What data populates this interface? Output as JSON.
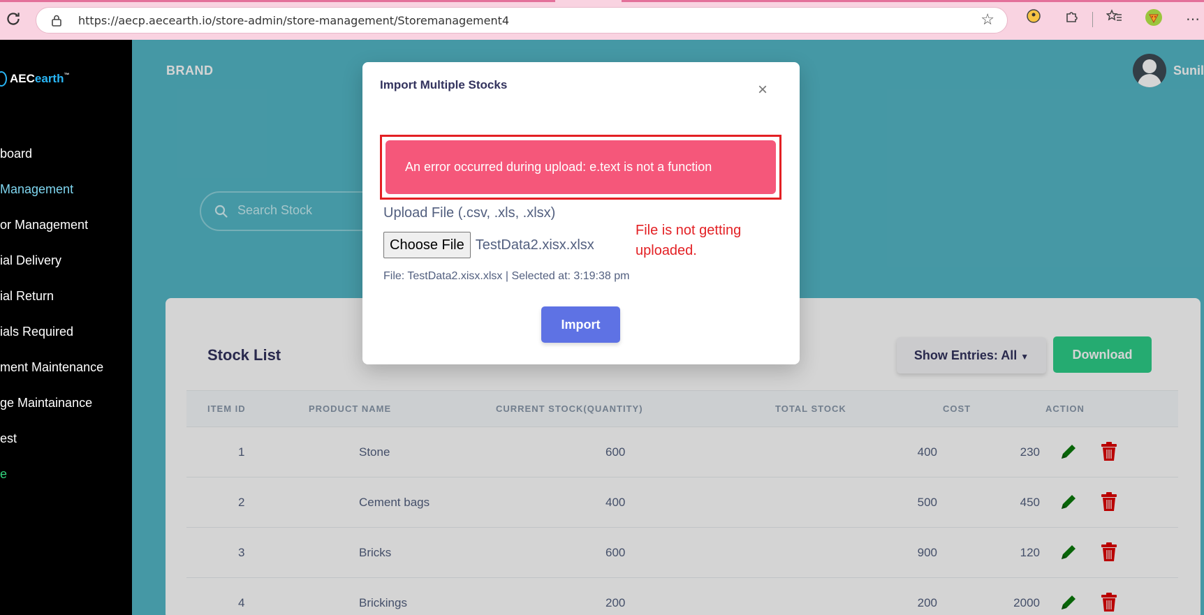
{
  "browser": {
    "url": "https://aecp.aecearth.io/store-admin/store-management/Storemanagement4"
  },
  "sidebar": {
    "logo": {
      "prefix": "AEC",
      "suffix": "earth",
      "tm": "™"
    },
    "items": [
      {
        "label": "board"
      },
      {
        "label": "Management"
      },
      {
        "label": "or Management"
      },
      {
        "label": "ial Delivery"
      },
      {
        "label": "ial Return"
      },
      {
        "label": "ials Required"
      },
      {
        "label": "ment Maintenance"
      },
      {
        "label": "ge Maintainance"
      },
      {
        "label": "est"
      },
      {
        "label": "e"
      }
    ]
  },
  "header": {
    "brand": "BRAND",
    "user_name": "Sunil"
  },
  "search": {
    "placeholder": "Search Stock"
  },
  "stock_list": {
    "title": "Stock List",
    "entries_label": "Show Entries: All",
    "download_label": "Download",
    "columns": [
      "ITEM ID",
      "PRODUCT NAME",
      "CURRENT STOCK(QUANTITY)",
      "TOTAL STOCK",
      "COST",
      "ACTION"
    ],
    "rows": [
      {
        "id": "1",
        "name": "Stone",
        "current": "600",
        "total": "400",
        "cost": "230"
      },
      {
        "id": "2",
        "name": "Cement bags",
        "current": "400",
        "total": "500",
        "cost": "450"
      },
      {
        "id": "3",
        "name": "Bricks",
        "current": "600",
        "total": "900",
        "cost": "120"
      },
      {
        "id": "4",
        "name": "Brickings",
        "current": "200",
        "total": "200",
        "cost": "2000"
      }
    ]
  },
  "modal": {
    "title": "Import Multiple Stocks",
    "close": "×",
    "error": "An error occurred during upload: e.text is not a function",
    "upload_label": "Upload File (.csv, .xls, .xlsx)",
    "choose_file": "Choose File",
    "file_name": "TestData2.xisx.xlsx",
    "annotation": "File is not getting uploaded.",
    "file_info": "File: TestData2.xisx.xlsx | Selected at: 3:19:38 pm",
    "import_label": "Import"
  },
  "colors": {
    "main_bg": "#54b7c7",
    "error_bg": "#f5577a",
    "annotation": "#e32024",
    "import_btn": "#5e72e4",
    "download_btn": "#2dce89",
    "edit_icon": "#0a7a0a",
    "delete_icon": "#e00000"
  }
}
